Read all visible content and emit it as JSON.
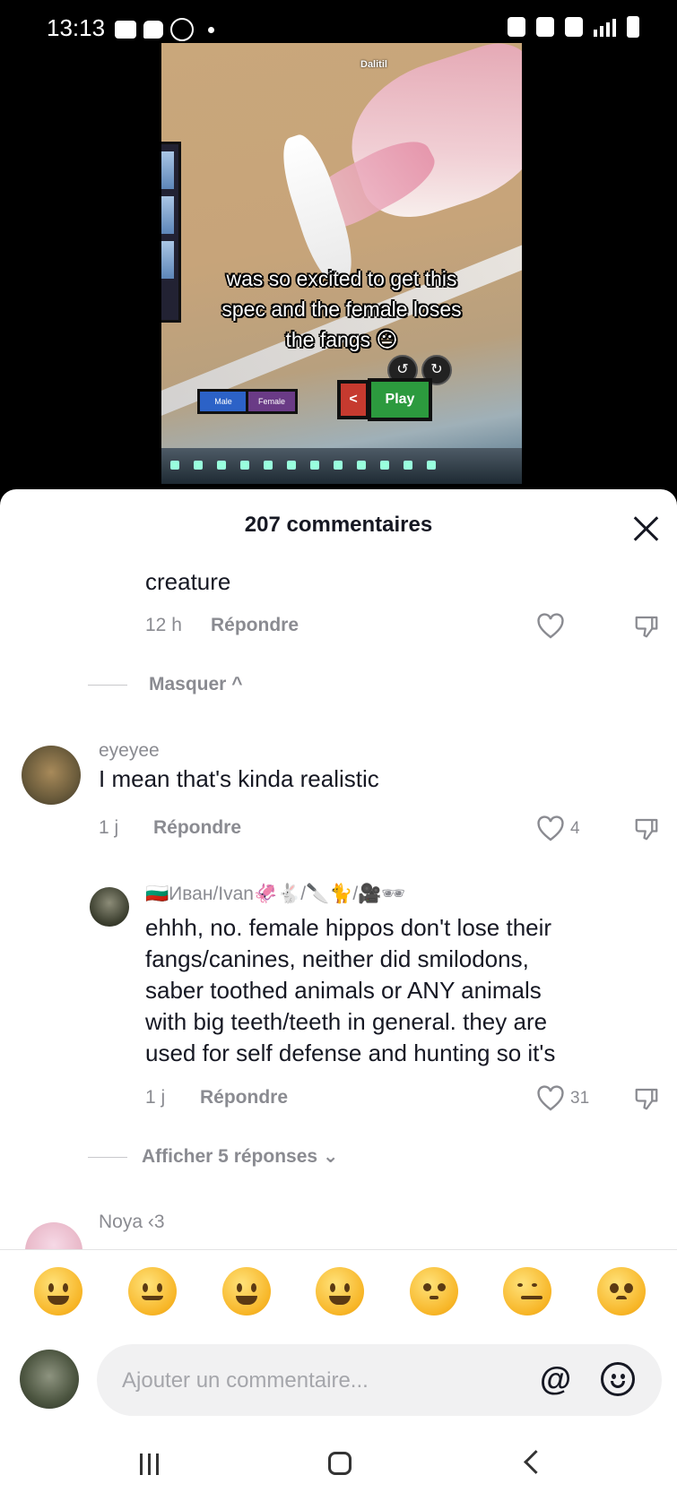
{
  "status_bar": {
    "time": "13:13"
  },
  "video": {
    "caption_lines": [
      "was so excited to get this",
      "spec and the female loses",
      "the fangs 😐"
    ],
    "game_name": "Dalitil",
    "male_label": "Male",
    "female_label": "Female",
    "back_label": "<",
    "play_label": "Play"
  },
  "comments_sheet": {
    "title": "207 commentaires",
    "comments": [
      {
        "text": "creature",
        "time": "12 h",
        "reply_label": "Répondre",
        "likes": ""
      },
      {
        "toggle": "Masquer ^"
      },
      {
        "username": "eyeyee",
        "text": "I mean that's kinda realistic",
        "time": "1 j",
        "reply_label": "Répondre",
        "likes": "4"
      },
      {
        "username": "🇧🇬Иван/Ivan🦑🐇/🔪🐈/🎥🕶",
        "text_lines": [
          "ehhh, no. female hippos don't lose their",
          "fangs/canines, neither did smilodons,",
          "saber toothed animals or ANY animals",
          "with big teeth/teeth in general. they are",
          "used for self defense and hunting so it's"
        ],
        "time": "1 j",
        "reply_label": "Répondre",
        "likes": "31"
      },
      {
        "toggle": "Afficher 5 réponses ⌄"
      },
      {
        "username": "Noya ‹3"
      }
    ],
    "emojis": [
      "grinning-sweat",
      "smiling-hearts",
      "beaming",
      "tears-of-joy",
      "flushed",
      "smirking",
      "pleading"
    ],
    "input": {
      "placeholder": "Ajouter un commentaire...",
      "at_label": "@"
    }
  },
  "colors": {
    "text_primary": "#161823",
    "text_secondary": "#8a8b91",
    "play_button": "#2c9a3e",
    "back_button": "#c63a2f"
  }
}
